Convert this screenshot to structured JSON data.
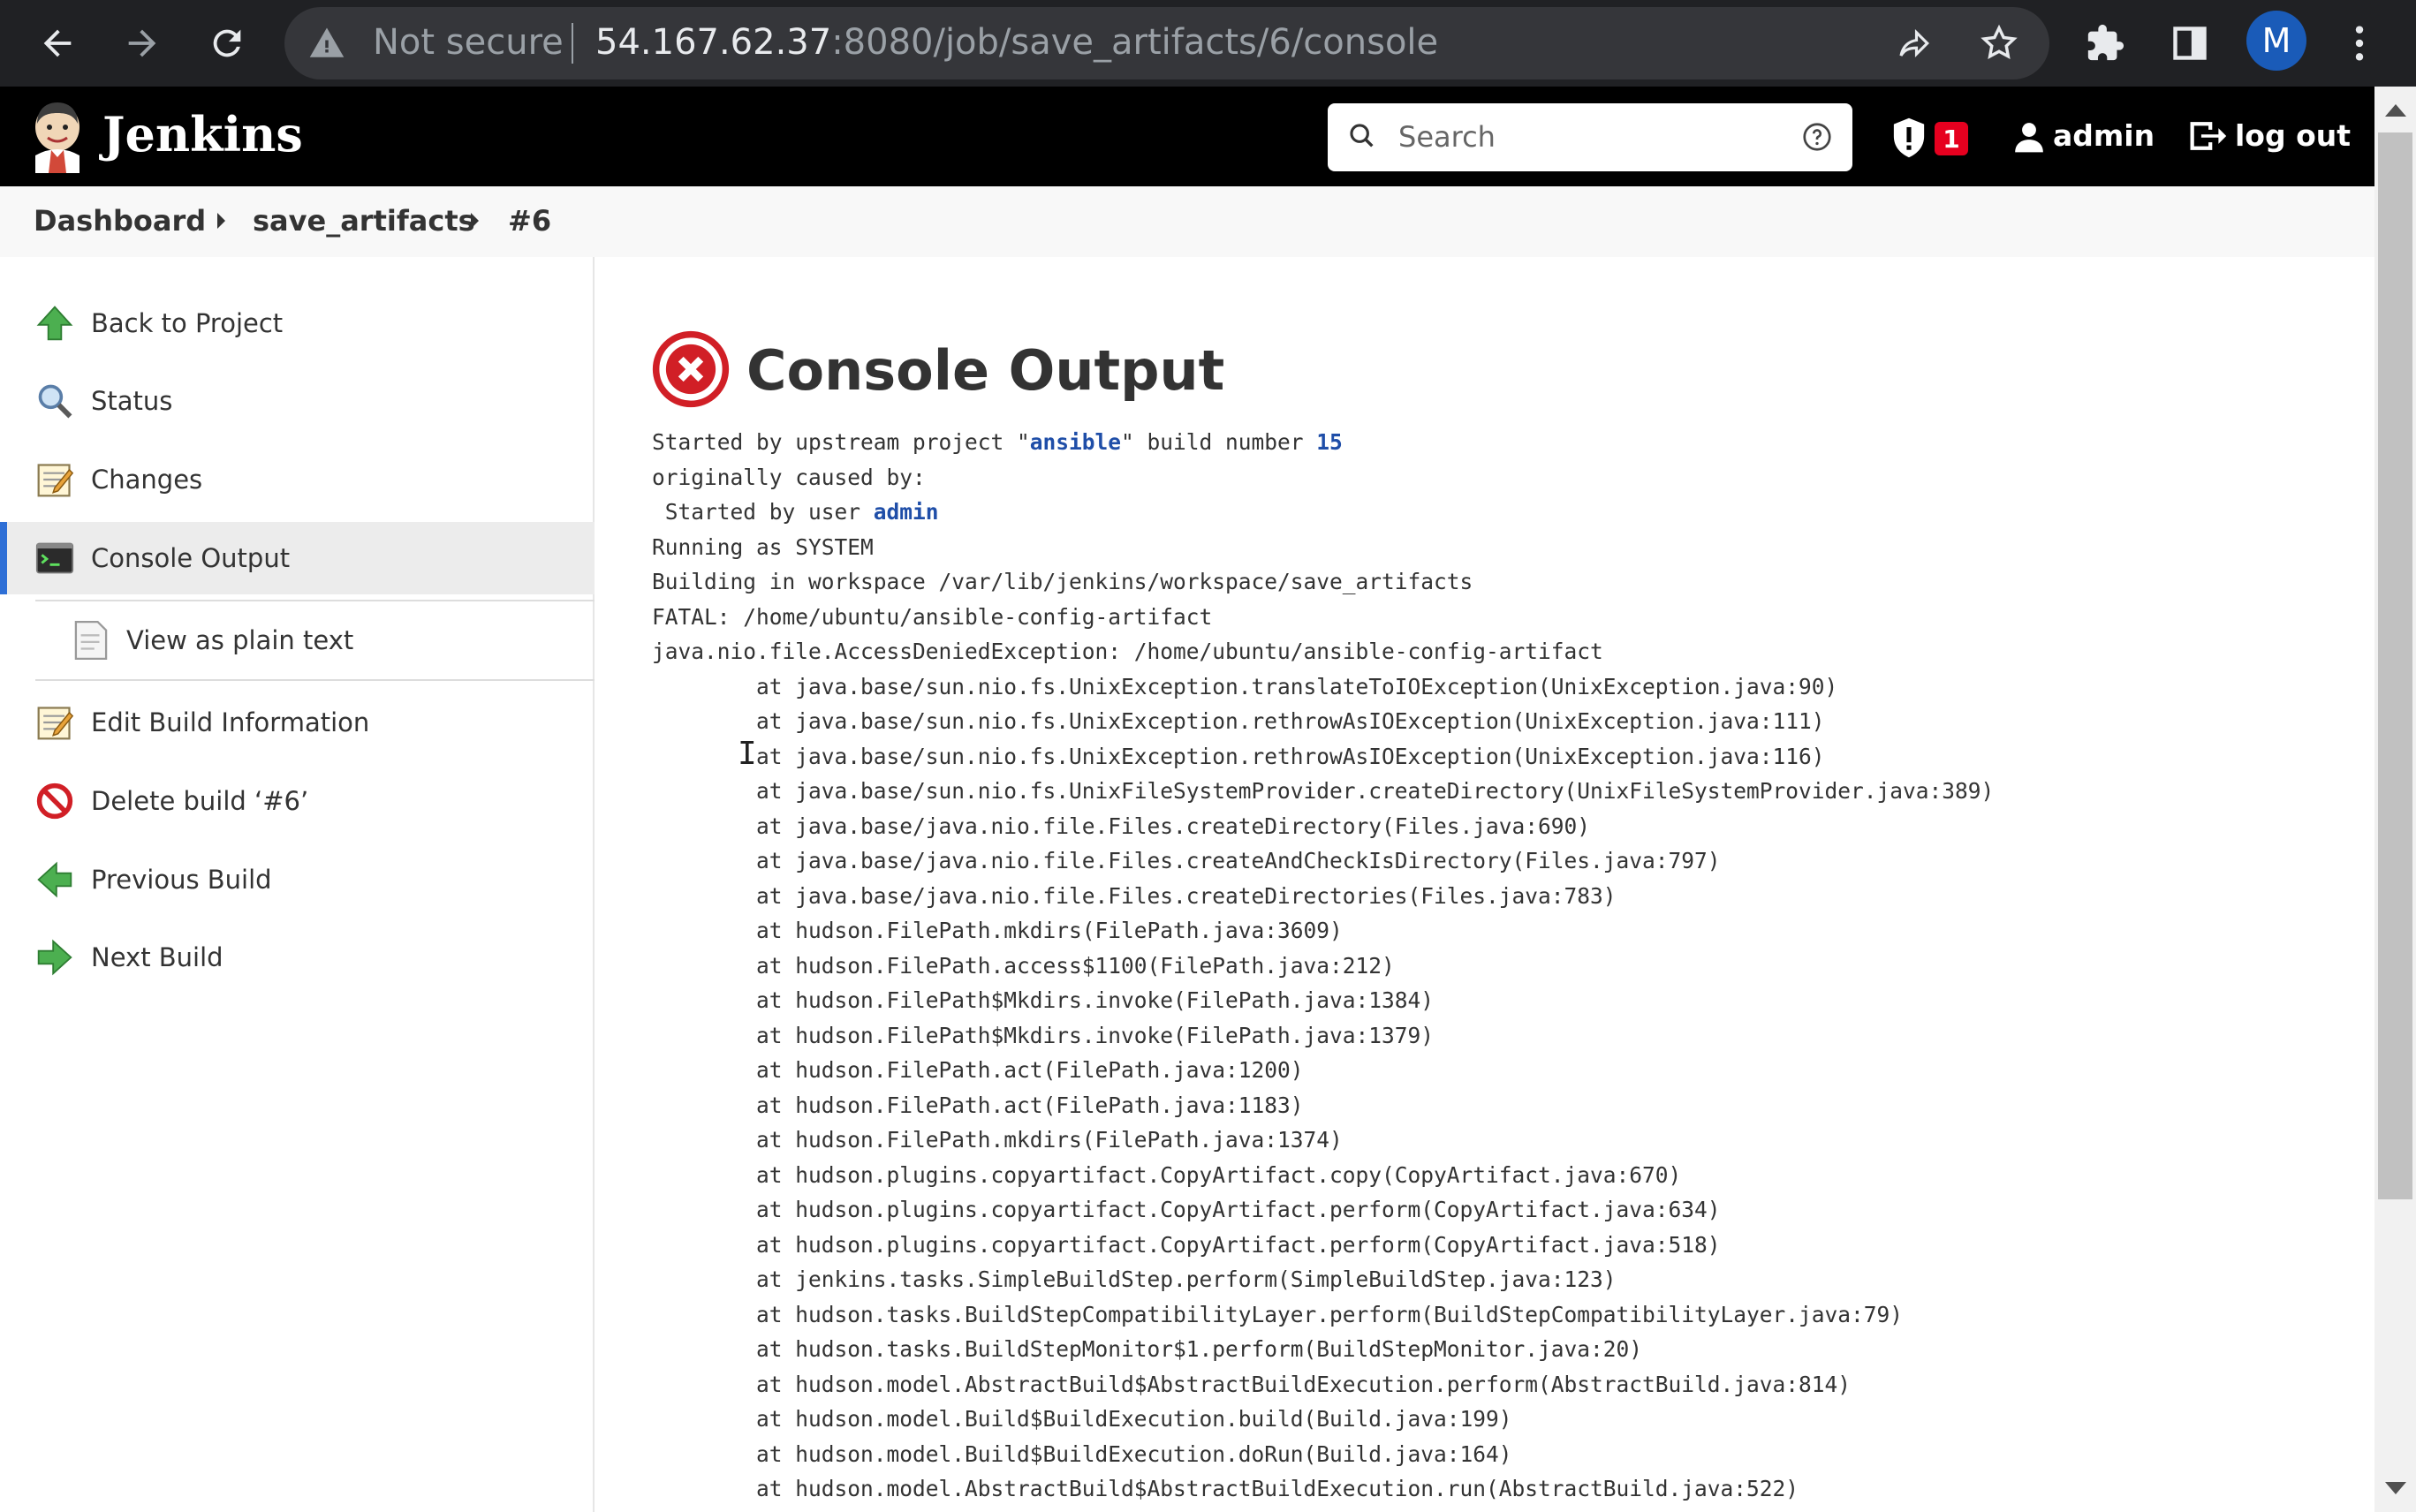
{
  "browser": {
    "security_label": "Not secure",
    "url_host": "54.167.62.37",
    "url_rest": ":8080/job/save_artifacts/6/console",
    "profile_initial": "M"
  },
  "header": {
    "app_title": "Jenkins",
    "search_placeholder": "Search",
    "security_badge_count": "1",
    "user_name": "admin",
    "logout_label": "log out"
  },
  "breadcrumb": {
    "items": [
      "Dashboard",
      "save_artifacts",
      "#6"
    ]
  },
  "sidebar": {
    "items": [
      {
        "label": "Back to Project",
        "icon": "up-arrow-icon"
      },
      {
        "label": "Status",
        "icon": "magnifier-icon"
      },
      {
        "label": "Changes",
        "icon": "notepad-icon"
      },
      {
        "label": "Console Output",
        "icon": "terminal-icon"
      },
      {
        "label": "View as plain text",
        "icon": "document-icon"
      },
      {
        "label": "Edit Build Information",
        "icon": "notepad-icon"
      },
      {
        "label": "Delete build ‘#6’",
        "icon": "no-entry-icon"
      },
      {
        "label": "Previous Build",
        "icon": "left-arrow-icon"
      },
      {
        "label": "Next Build",
        "icon": "right-arrow-icon"
      }
    ],
    "active_item": "Console Output"
  },
  "main": {
    "title": "Console Output",
    "console": {
      "line1_pre": "Started by upstream project \"",
      "line1_project": "ansible",
      "line1_mid": "\" build number ",
      "line1_build": "15",
      "line2": "originally caused by:",
      "line3_pre": " Started by user ",
      "line3_user": "admin",
      "lines": [
        "Running as SYSTEM",
        "Building in workspace /var/lib/jenkins/workspace/save_artifacts",
        "FATAL: /home/ubuntu/ansible-config-artifact",
        "java.nio.file.AccessDeniedException: /home/ubuntu/ansible-config-artifact",
        "\tat java.base/sun.nio.fs.UnixException.translateToIOException(UnixException.java:90)",
        "\tat java.base/sun.nio.fs.UnixException.rethrowAsIOException(UnixException.java:111)",
        "\tat java.base/sun.nio.fs.UnixException.rethrowAsIOException(UnixException.java:116)",
        "\tat java.base/sun.nio.fs.UnixFileSystemProvider.createDirectory(UnixFileSystemProvider.java:389)",
        "\tat java.base/java.nio.file.Files.createDirectory(Files.java:690)",
        "\tat java.base/java.nio.file.Files.createAndCheckIsDirectory(Files.java:797)",
        "\tat java.base/java.nio.file.Files.createDirectories(Files.java:783)",
        "\tat hudson.FilePath.mkdirs(FilePath.java:3609)",
        "\tat hudson.FilePath.access$1100(FilePath.java:212)",
        "\tat hudson.FilePath$Mkdirs.invoke(FilePath.java:1384)",
        "\tat hudson.FilePath$Mkdirs.invoke(FilePath.java:1379)",
        "\tat hudson.FilePath.act(FilePath.java:1200)",
        "\tat hudson.FilePath.act(FilePath.java:1183)",
        "\tat hudson.FilePath.mkdirs(FilePath.java:1374)",
        "\tat hudson.plugins.copyartifact.CopyArtifact.copy(CopyArtifact.java:670)",
        "\tat hudson.plugins.copyartifact.CopyArtifact.perform(CopyArtifact.java:634)",
        "\tat hudson.plugins.copyartifact.CopyArtifact.perform(CopyArtifact.java:518)",
        "\tat jenkins.tasks.SimpleBuildStep.perform(SimpleBuildStep.java:123)",
        "\tat hudson.tasks.BuildStepCompatibilityLayer.perform(BuildStepCompatibilityLayer.java:79)",
        "\tat hudson.tasks.BuildStepMonitor$1.perform(BuildStepMonitor.java:20)",
        "\tat hudson.model.AbstractBuild$AbstractBuildExecution.perform(AbstractBuild.java:814)",
        "\tat hudson.model.Build$BuildExecution.build(Build.java:199)",
        "\tat hudson.model.Build$BuildExecution.doRun(Build.java:164)",
        "\tat hudson.model.AbstractBuild$AbstractBuildExecution.run(AbstractBuild.java:522)"
      ]
    }
  },
  "colors": {
    "jenkins_header": "#000000",
    "link_blue": "#1f4ea8",
    "failure_red": "#d11f26",
    "active_accent": "#2e6fd6"
  }
}
